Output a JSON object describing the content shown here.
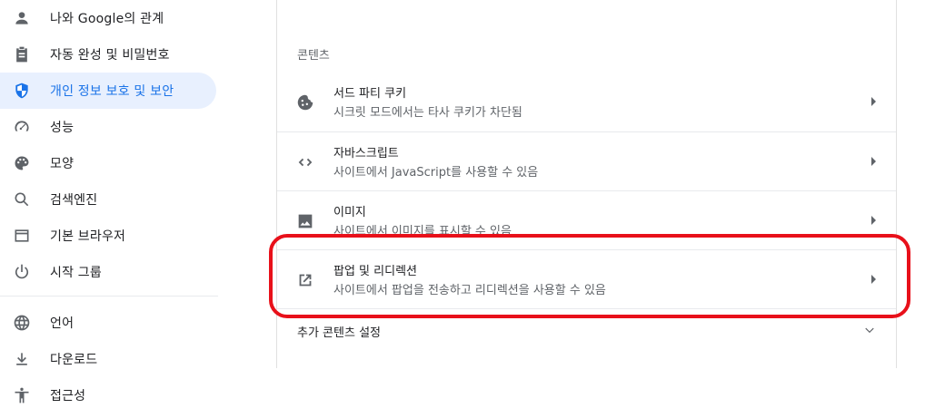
{
  "sidebar": {
    "items": [
      {
        "label": "나와 Google의 관계",
        "icon": "person-icon"
      },
      {
        "label": "자동 완성 및 비밀번호",
        "icon": "clipboard-icon"
      },
      {
        "label": "개인 정보 보호 및 보안",
        "icon": "shield-icon",
        "active": true
      },
      {
        "label": "성능",
        "icon": "speedometer-icon"
      },
      {
        "label": "모양",
        "icon": "palette-icon"
      },
      {
        "label": "검색엔진",
        "icon": "search-icon"
      },
      {
        "label": "기본 브라우저",
        "icon": "browser-window-icon"
      },
      {
        "label": "시작 그룹",
        "icon": "power-icon"
      },
      {
        "label": "언어",
        "icon": "globe-icon"
      },
      {
        "label": "다운로드",
        "icon": "download-icon"
      },
      {
        "label": "접근성",
        "icon": "accessibility-icon"
      }
    ]
  },
  "content": {
    "section_title": "콘텐츠",
    "rows": [
      {
        "title": "서드 파티 쿠키",
        "subtitle": "시크릿 모드에서는 타사 쿠키가 차단됨",
        "icon": "cookie-icon"
      },
      {
        "title": "자바스크립트",
        "subtitle": "사이트에서 JavaScript를 사용할 수 있음",
        "icon": "code-icon"
      },
      {
        "title": "이미지",
        "subtitle": "사이트에서 이미지를 표시할 수 있음",
        "icon": "image-icon"
      },
      {
        "title": "팝업 및 리디렉션",
        "subtitle": "사이트에서 팝업을 전송하고 리디렉션을 사용할 수 있음",
        "icon": "open-in-new-icon"
      }
    ],
    "more_label": "추가 콘텐츠 설정"
  },
  "colors": {
    "accent": "#1a73e8",
    "active_bg": "#e8f0fe",
    "highlight": "#e8101a"
  }
}
